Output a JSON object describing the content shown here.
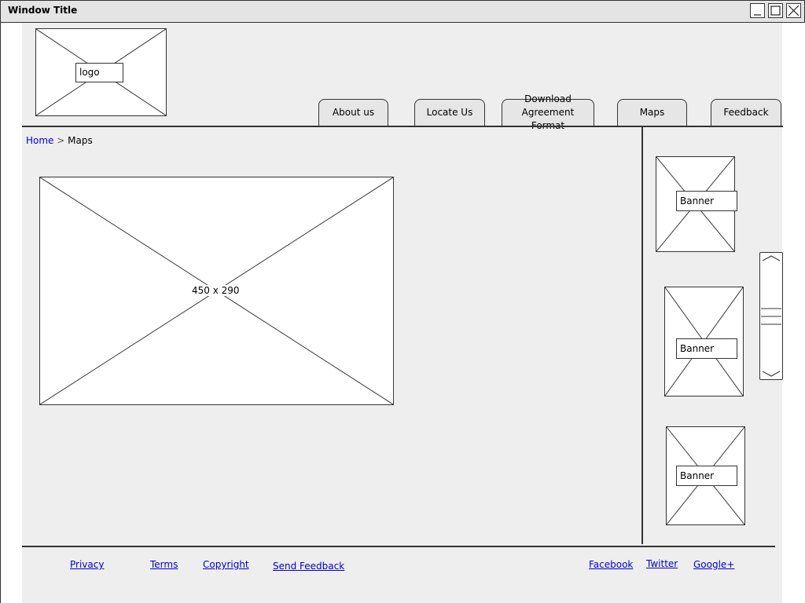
{
  "window": {
    "title": "Window Title",
    "buttons": [
      "minimize",
      "maximize",
      "close"
    ]
  },
  "header": {
    "logo_label": "logo",
    "tabs": [
      {
        "label": "About us"
      },
      {
        "label": "Locate Us"
      },
      {
        "label": "Download Agreement Format"
      },
      {
        "label": "Maps"
      },
      {
        "label": "Feedback"
      }
    ]
  },
  "breadcrumb": {
    "home": "Home",
    "separator": ">",
    "current": "Maps"
  },
  "main": {
    "image_label": "450 x 290"
  },
  "sidebar": {
    "banners": [
      {
        "label": "Banner"
      },
      {
        "label": "Banner"
      },
      {
        "label": "Banner"
      }
    ]
  },
  "footer": {
    "left_links": [
      "Privacy",
      "Terms",
      "Copyright",
      "Send Feedback"
    ],
    "right_links": [
      "Facebook",
      "Twitter",
      "Google+"
    ]
  },
  "colors": {
    "link": "#0000cc",
    "content_bg": "#eeeeee",
    "titlebar_bg": "#e4e4e4"
  }
}
